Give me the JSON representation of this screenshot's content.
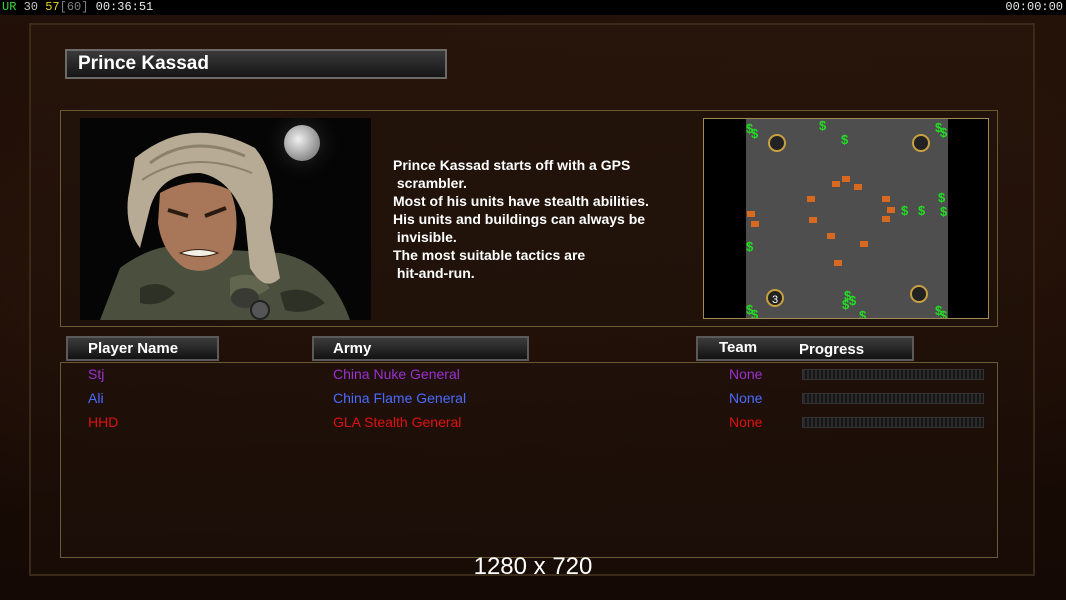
{
  "topbar": {
    "ur": "UR",
    "num1": "30",
    "num2": "57",
    "bracket": "[60]",
    "game_time": "00:36:51",
    "right_time": "00:00:00"
  },
  "general": {
    "name": "Prince Kassad",
    "description_lines": [
      "Prince Kassad starts off with a GPS",
      " scrambler.",
      "Most of his units have stealth abilities.",
      "His units and buildings can always be",
      " invisible.",
      "The most suitable tactics are",
      " hit-and-run."
    ]
  },
  "minimap": {
    "start_label": "3"
  },
  "columns": {
    "player_name": "Player Name",
    "army": "Army",
    "team": "Team",
    "progress": "Progress"
  },
  "players": [
    {
      "name": "Stj",
      "army": "China Nuke General",
      "team": "None",
      "color": "#9b30d0"
    },
    {
      "name": "Ali",
      "army": "China Flame General",
      "team": "None",
      "color": "#4a6cff"
    },
    {
      "name": "HHD",
      "army": "GLA Stealth General",
      "team": "None",
      "color": "#e01010"
    }
  ],
  "colors": {
    "ur": "#38d838",
    "num1": "#c8c8c8",
    "num2": "#e8d020",
    "bracket": "#808080",
    "money": "#22dd22",
    "building": "#d86a20"
  },
  "resolution_label": "1280 x 720"
}
